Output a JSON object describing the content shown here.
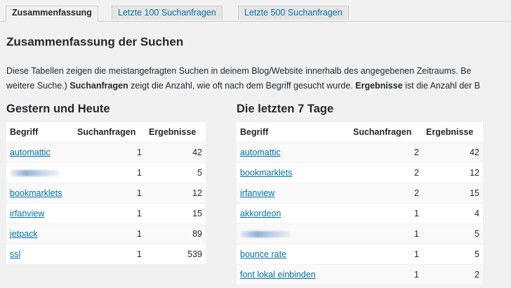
{
  "tabs": [
    {
      "label": "Zusammenfassung",
      "active": true
    },
    {
      "label": "Letzte 100 Suchanfragen",
      "active": false
    },
    {
      "label": "Letzte 500 Suchanfragen",
      "active": false
    }
  ],
  "page_title": "Zusammenfassung der Suchen",
  "description": {
    "line1": "Diese Tabellen zeigen die meistangefragten Suchen in deinem Blog/Website innerhalb des angegebenen Zeitraums. Be",
    "line2_pre": "weitere Suche.) ",
    "line2_bold1": "Suchanfragen",
    "line2_mid": " zeigt die Anzahl, wie oft nach dem Begriff gesucht wurde. ",
    "line2_bold2": "Ergebnisse",
    "line2_post": " ist die Anzahl der B"
  },
  "columns": {
    "term": "Begriff",
    "queries": "Suchanfragen",
    "results": "Ergebnisse"
  },
  "tables": [
    {
      "title": "Gestern und Heute",
      "rows": [
        {
          "term": "automattic",
          "queries": "1",
          "results": "42",
          "blurred": false
        },
        {
          "term": "",
          "queries": "1",
          "results": "5",
          "blurred": true
        },
        {
          "term": "bookmarklets",
          "queries": "1",
          "results": "12",
          "blurred": false
        },
        {
          "term": "irfanview",
          "queries": "1",
          "results": "15",
          "blurred": false
        },
        {
          "term": "jetpack",
          "queries": "1",
          "results": "89",
          "blurred": false
        },
        {
          "term": "ssl",
          "queries": "1",
          "results": "539",
          "blurred": false
        }
      ]
    },
    {
      "title": "Die letzten 7 Tage",
      "rows": [
        {
          "term": "automattic",
          "queries": "2",
          "results": "42",
          "blurred": false
        },
        {
          "term": "bookmarklets",
          "queries": "2",
          "results": "12",
          "blurred": false
        },
        {
          "term": "irfanview",
          "queries": "2",
          "results": "15",
          "blurred": false
        },
        {
          "term": "akkordeon",
          "queries": "1",
          "results": "4",
          "blurred": false
        },
        {
          "term": "",
          "queries": "1",
          "results": "5",
          "blurred": true
        },
        {
          "term": "bounce rate",
          "queries": "1",
          "results": "5",
          "blurred": false
        },
        {
          "term": "font lokal einbinden",
          "queries": "1",
          "results": "2",
          "blurred": false
        }
      ]
    }
  ],
  "colors": {
    "link": "#0073aa",
    "background": "#f1f1f1",
    "text": "#23282d"
  }
}
